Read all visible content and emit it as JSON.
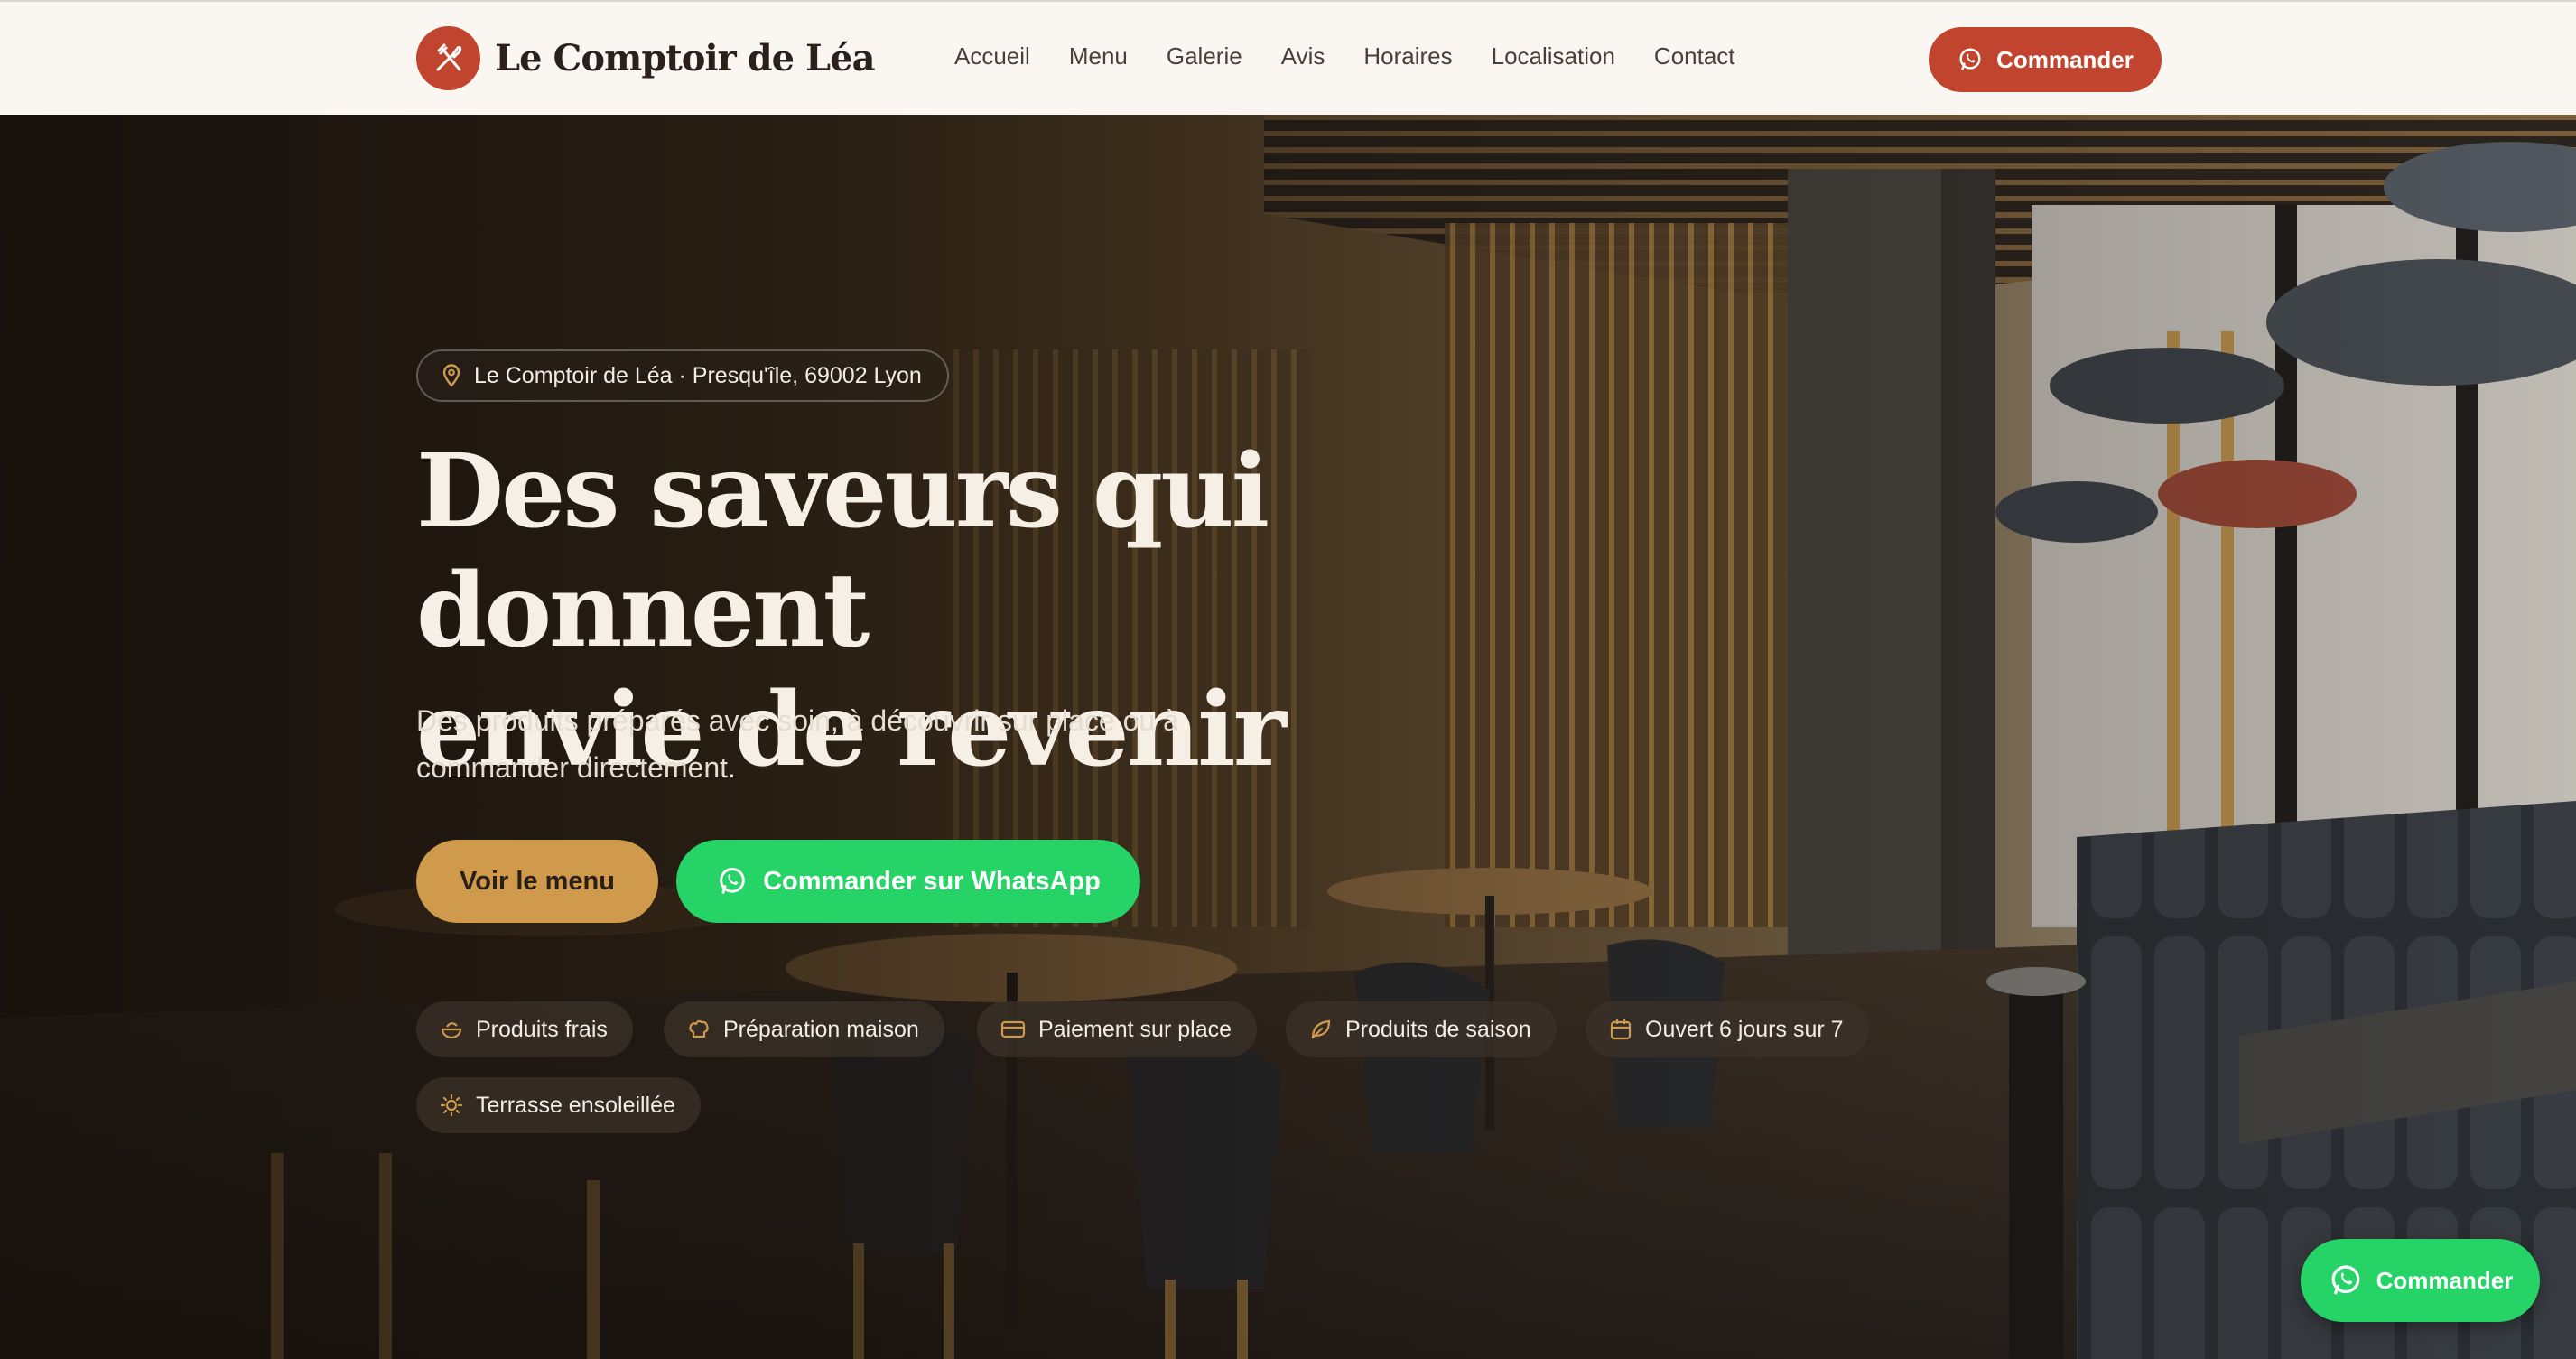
{
  "brand": {
    "name": "Le Comptoir de Léa",
    "icon": "utensils-crossed-icon",
    "color": "#c1442e"
  },
  "nav": {
    "links": [
      "Accueil",
      "Menu",
      "Galerie",
      "Avis",
      "Horaires",
      "Localisation",
      "Contact"
    ],
    "cta_label": "Commander"
  },
  "hero": {
    "location_label": "Le Comptoir de Léa · Presqu'île, 69002 Lyon",
    "title_line1": "Des saveurs qui donnent",
    "title_line2": "envie de revenir",
    "subtitle_line1": "Des produits préparés avec soin, à découvrir sur place ou à",
    "subtitle_line2": "commander directement.",
    "menu_button_label": "Voir le menu",
    "whatsapp_button_label": "Commander sur WhatsApp",
    "features": [
      {
        "label": "Produits frais",
        "icon": "bowl-icon"
      },
      {
        "label": "Préparation maison",
        "icon": "chef-hat-icon"
      },
      {
        "label": "Paiement sur place",
        "icon": "credit-card-icon"
      },
      {
        "label": "Produits de saison",
        "icon": "leaf-icon"
      },
      {
        "label": "Ouvert 6 jours sur 7",
        "icon": "calendar-icon"
      },
      {
        "label": "Terrasse ensoleillée",
        "icon": "sun-icon"
      }
    ]
  },
  "floating": {
    "label": "Commander"
  },
  "colors": {
    "whatsapp": "#25d366",
    "gold": "#cf9a4c",
    "accent": "#c1442e"
  }
}
